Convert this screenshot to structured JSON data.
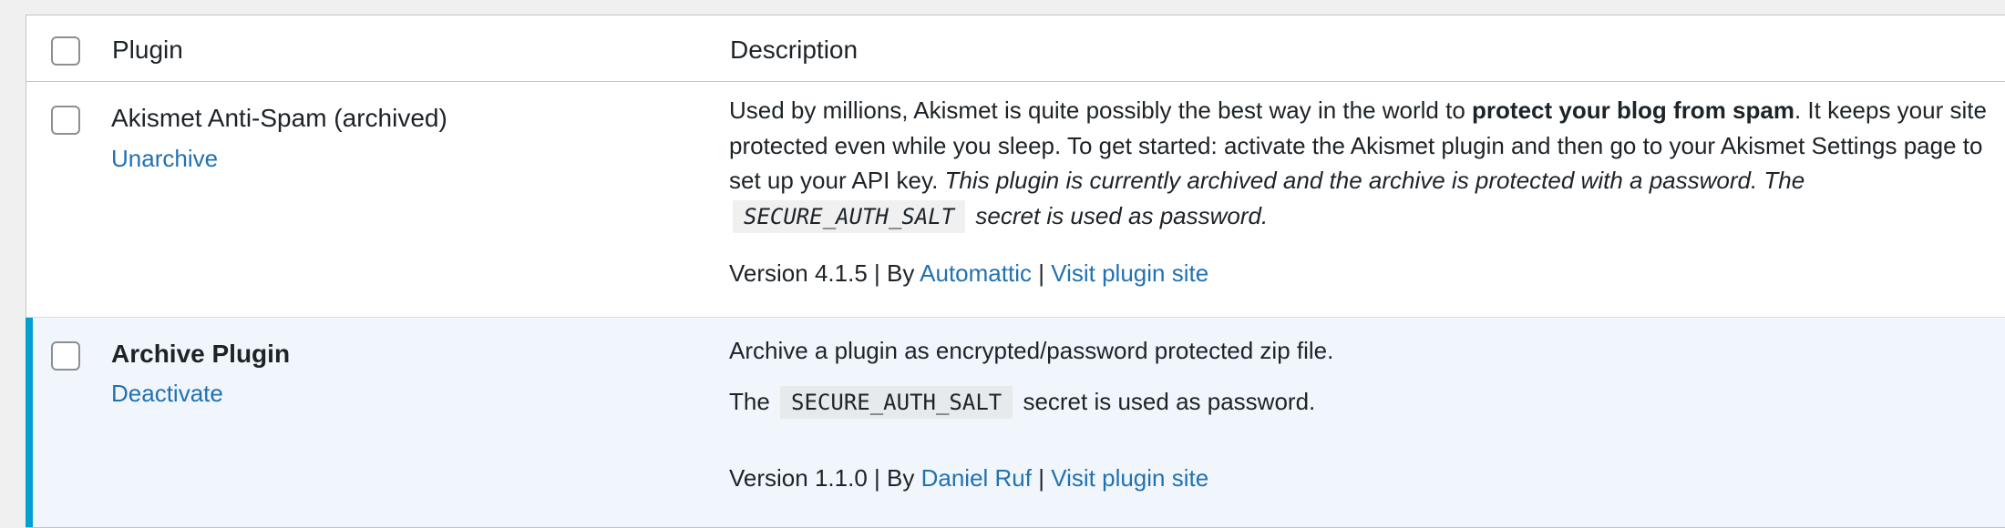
{
  "header": {
    "plugin_col": "Plugin",
    "description_col": "Description"
  },
  "plugins": [
    {
      "name": "Akismet Anti-Spam (archived)",
      "action": "Unarchive",
      "desc_part1": "Used by millions, Akismet is quite possibly the best way in the world to ",
      "desc_bold": "protect your blog from spam",
      "desc_part2": ". It keeps your site protected even while you sleep. To get started: activate the Akismet plugin and then go to your Akismet Settings page to set up your API key. ",
      "desc_italic1": "This plugin is currently archived and the archive is protected with a password. The ",
      "desc_code": "SECURE_AUTH_SALT",
      "desc_italic2": " secret is used as password.",
      "version": "Version 4.1.5",
      "by": "By",
      "author": "Automattic",
      "site_link": "Visit plugin site"
    },
    {
      "name": "Archive Plugin",
      "action": "Deactivate",
      "desc_line1": "Archive a plugin as encrypted/password protected zip file.",
      "desc_line2_pre": "The ",
      "desc_code": "SECURE_AUTH_SALT",
      "desc_line2_post": " secret is used as password.",
      "version": "Version 1.1.0",
      "by": "By",
      "author": "Daniel Ruf",
      "site_link": "Visit plugin site"
    }
  ],
  "colors": {
    "link": "#2271b1",
    "active_bar": "#00a0d2",
    "active_bg": "#f0f6fc"
  }
}
